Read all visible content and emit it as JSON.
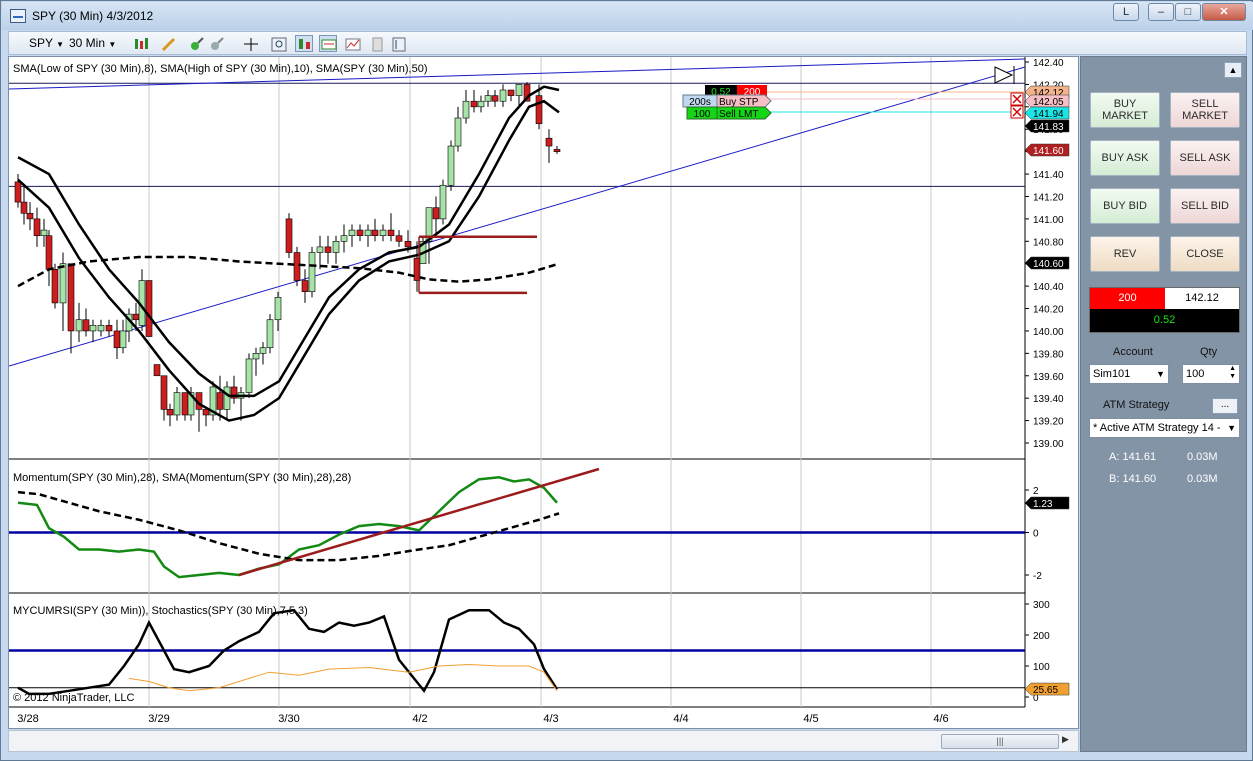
{
  "window": {
    "title": "SPY (30 Min)  4/3/2012",
    "btn_l": "L",
    "btn_min": "–",
    "btn_max": "□",
    "btn_close": "✕"
  },
  "toolbar": {
    "instrument": "SPY",
    "interval": "30 Min"
  },
  "chart": {
    "price_panel_label": "SMA(Low of SPY (30 Min),8), SMA(High of SPY (30 Min),10), SMA(SPY (30 Min),50)",
    "momentum_panel_label": "Momentum(SPY (30 Min),28), SMA(Momentum(SPY (30 Min),28),28)",
    "rsi_panel_label": "MYCUMRSI(SPY (30 Min)), Stochastics(SPY (30 Min),7,5,3)",
    "copyright": "© 2012 NinjaTrader, LLC",
    "price_ticks": [
      "142.40",
      "142.20",
      "142.00",
      "141.80",
      "141.60",
      "141.40",
      "141.20",
      "141.00",
      "140.80",
      "140.60",
      "140.40",
      "140.20",
      "140.00",
      "139.80",
      "139.60",
      "139.40",
      "139.20",
      "139.00"
    ],
    "momentum_ticks": [
      "2",
      "0",
      "-2"
    ],
    "rsi_ticks": [
      "300",
      "200",
      "100",
      "0"
    ],
    "x_ticks": [
      "3/28",
      "3/29",
      "3/30",
      "4/2",
      "4/3",
      "4/4",
      "4/5",
      "4/6"
    ],
    "price_markers": {
      "ask": "142.12",
      "stop": "142.05",
      "limit": "141.94",
      "last": "141.83",
      "prev": "141.60",
      "sma50": "140.60"
    },
    "momentum_marker": "1.23",
    "rsi_marker": "25.65",
    "orders": {
      "pnl": "0.52",
      "qty": "200",
      "stp_qty": "200s",
      "stp_label": "Buy STP",
      "lmt_qty": "100",
      "lmt_label": "Sell LMT"
    },
    "colors": {
      "up_candle": "#a6e3a6",
      "down_candle": "#cc1e1e",
      "ask": "#f3b48b",
      "stop": "#f6bfc6",
      "limit": "#19e6e6",
      "position": "#ff0000",
      "pnl_bg": "#000000",
      "sma_momentum": "#000000",
      "momentum": "#138a13",
      "trend_red": "#9b1c1c",
      "trend_blue": "#1919c8",
      "zero_line": "#0000a0",
      "stoch": "#f0a030"
    }
  },
  "chart_data": [
    {
      "type": "line",
      "title": "SMA(Low of SPY (30 Min),8), SMA(High of SPY (30 Min),10), SMA(SPY (30 Min),50)",
      "xlabel": "",
      "ylabel": "",
      "ylim": [
        138.9,
        142.45
      ],
      "categories": [
        "3/28",
        "3/29",
        "3/30",
        "4/2",
        "4/3"
      ],
      "series": [
        {
          "name": "SMA(Low of SPY (30 Min),8)",
          "values": [
            141.2,
            139.9,
            139.4,
            140.7,
            142.1
          ]
        },
        {
          "name": "SMA(High of SPY (30 Min),10)",
          "values": [
            141.45,
            140.2,
            139.6,
            140.85,
            142.2
          ]
        },
        {
          "name": "SMA(SPY (30 Min),50)",
          "values": [
            140.4,
            140.65,
            140.6,
            140.45,
            140.6
          ]
        }
      ]
    },
    {
      "type": "line",
      "title": "Momentum(SPY (30 Min),28), SMA(Momentum(SPY (30 Min),28),28)",
      "xlabel": "",
      "ylabel": "",
      "ylim": [
        -2.5,
        2.5
      ],
      "categories": [
        "3/28",
        "3/29",
        "3/30",
        "4/2",
        "4/3"
      ],
      "series": [
        {
          "name": "Momentum(SPY (30 Min),28)",
          "values": [
            1.3,
            -0.8,
            -1.5,
            0.3,
            1.4
          ]
        },
        {
          "name": "SMA(Momentum(SPY (30 Min),28),28)",
          "values": [
            1.9,
            0.2,
            -1.2,
            -0.6,
            1.1
          ]
        }
      ]
    },
    {
      "type": "line",
      "title": "MYCUMRSI(SPY (30 Min)), Stochastics(SPY (30 Min),7,5,3)",
      "xlabel": "",
      "ylabel": "",
      "ylim": [
        0,
        320
      ],
      "categories": [
        "3/28",
        "3/29",
        "3/30",
        "4/2",
        "4/3"
      ],
      "series": [
        {
          "name": "MYCUMRSI(SPY (30 Min))",
          "values": [
            10,
            240,
            290,
            20,
            26
          ]
        },
        {
          "name": "Stochastics(SPY (30 Min),7,5,3)",
          "values": [
            15,
            40,
            90,
            40,
            25
          ]
        }
      ]
    }
  ],
  "panel": {
    "buy_market": "BUY MARKET",
    "sell_market": "SELL MARKET",
    "buy_ask": "BUY ASK",
    "sell_ask": "SELL ASK",
    "buy_bid": "BUY BID",
    "sell_bid": "SELL BID",
    "rev": "REV",
    "close": "CLOSE",
    "position_qty": "200",
    "position_price": "142.12",
    "pnl": "0.52",
    "account_label": "Account",
    "account_value": "Sim101",
    "qty_label": "Qty",
    "qty_value": "100",
    "atm_label": "ATM Strategy",
    "atm_button": "...",
    "atm_value": "* Active ATM Strategy 14 -",
    "ask_line": "A: 141.61",
    "ask_size": "0.03M",
    "bid_line": "B: 141.60",
    "bid_size": "0.03M"
  }
}
